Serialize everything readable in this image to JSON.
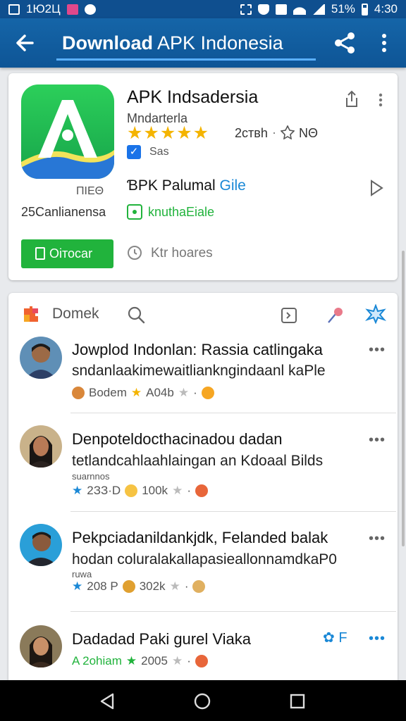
{
  "status_bar": {
    "left_text": "1Ю2Ц",
    "battery_text": "51%",
    "time": "4:30"
  },
  "app_bar": {
    "title_bold": "Download",
    "title_rest": " APK Indonesia"
  },
  "app_card": {
    "name": "APK Indsadersia",
    "developer": "Mndarterla",
    "stars": "★★★★★",
    "rating_text": "2ствh",
    "size_text": "ΝΘ",
    "verified_text": "Sas",
    "left_small": "ΠΙΕΘ",
    "left_label": "25Canlianensa",
    "related_title": "ƁPK Palumal",
    "related_link": "Gile",
    "tag_text": "knuthaEiale",
    "download_label": "Oiтоcar",
    "views_text": "Ktr hoares"
  },
  "feed": {
    "header_label": "Domek",
    "items": [
      {
        "title": "Jowplod Indonlan: Rassia catlingaka",
        "subtitle": "sndanlaakimewaitlianknginda­anl kaPle",
        "tiny": "",
        "meta_name": "Bodem",
        "meta_num": "A04b"
      },
      {
        "title": "Denpoteldocthacinadou dadan",
        "subtitle": "tetlandcahlaahlaingan an Kdoaal Bilds",
        "tiny": "suarnnos",
        "meta_name": "2ЗЗ·D",
        "meta_num": "100k"
      },
      {
        "title": "Pekpciadanildankjdk, Felanded balak",
        "subtitle": "hodan coluralakallapasieallonnamdkaP0",
        "tiny": "ruwa",
        "meta_name": "208 P",
        "meta_num": "302k"
      },
      {
        "title": "Dadadad Paki gurel Viaka",
        "subtitle": "",
        "tiny": "",
        "meta_name": "A 2ohiam",
        "meta_num": "2005"
      }
    ],
    "item4_badge": "F"
  },
  "colors": {
    "appbar": "#1565a8",
    "accent_green": "#21b33c",
    "link_blue": "#1a73e8",
    "star": "#f4b400"
  }
}
